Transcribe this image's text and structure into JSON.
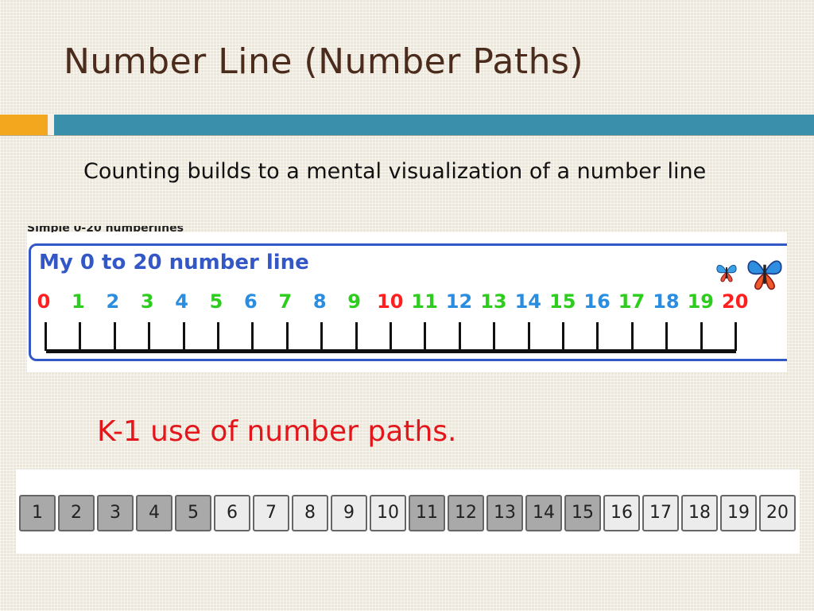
{
  "slide": {
    "title": "Number Line (Number Paths)",
    "subtitle": "Counting builds to a mental visualization of a number line",
    "k1_caption": "K-1 use of number paths."
  },
  "number_line": {
    "caption": "Simple 0-20 numberlines",
    "heading": "My 0 to 20 number line",
    "numbers": [
      {
        "label": "0",
        "color": "#ff1f1f"
      },
      {
        "label": "1",
        "color": "#2ecc1e"
      },
      {
        "label": "2",
        "color": "#2a8de0"
      },
      {
        "label": "3",
        "color": "#2ecc1e"
      },
      {
        "label": "4",
        "color": "#2a8de0"
      },
      {
        "label": "5",
        "color": "#2ecc1e"
      },
      {
        "label": "6",
        "color": "#2a8de0"
      },
      {
        "label": "7",
        "color": "#2ecc1e"
      },
      {
        "label": "8",
        "color": "#2a8de0"
      },
      {
        "label": "9",
        "color": "#2ecc1e"
      },
      {
        "label": "10",
        "color": "#ff1f1f"
      },
      {
        "label": "11",
        "color": "#2ecc1e"
      },
      {
        "label": "12",
        "color": "#2a8de0"
      },
      {
        "label": "13",
        "color": "#2ecc1e"
      },
      {
        "label": "14",
        "color": "#2a8de0"
      },
      {
        "label": "15",
        "color": "#2ecc1e"
      },
      {
        "label": "16",
        "color": "#2a8de0"
      },
      {
        "label": "17",
        "color": "#2ecc1e"
      },
      {
        "label": "18",
        "color": "#2a8de0"
      },
      {
        "label": "19",
        "color": "#2ecc1e"
      },
      {
        "label": "20",
        "color": "#ff1f1f"
      }
    ],
    "icons": [
      "butterfly-icon",
      "butterfly-icon"
    ]
  },
  "number_path": {
    "boxes": [
      {
        "label": "1",
        "shade": "dark"
      },
      {
        "label": "2",
        "shade": "dark"
      },
      {
        "label": "3",
        "shade": "dark"
      },
      {
        "label": "4",
        "shade": "dark"
      },
      {
        "label": "5",
        "shade": "dark"
      },
      {
        "label": "6",
        "shade": "light"
      },
      {
        "label": "7",
        "shade": "light"
      },
      {
        "label": "8",
        "shade": "light"
      },
      {
        "label": "9",
        "shade": "light"
      },
      {
        "label": "10",
        "shade": "light"
      },
      {
        "label": "11",
        "shade": "dark"
      },
      {
        "label": "12",
        "shade": "dark"
      },
      {
        "label": "13",
        "shade": "dark"
      },
      {
        "label": "14",
        "shade": "dark"
      },
      {
        "label": "15",
        "shade": "dark"
      },
      {
        "label": "16",
        "shade": "light"
      },
      {
        "label": "17",
        "shade": "light"
      },
      {
        "label": "18",
        "shade": "light"
      },
      {
        "label": "19",
        "shade": "light"
      },
      {
        "label": "20",
        "shade": "light"
      }
    ]
  },
  "colors": {
    "title": "#4a2b1c",
    "accent_orange": "#f3a71e",
    "accent_teal": "#3a8faa",
    "k1_red": "#e4161b",
    "number_line_blue": "#3457c7"
  }
}
